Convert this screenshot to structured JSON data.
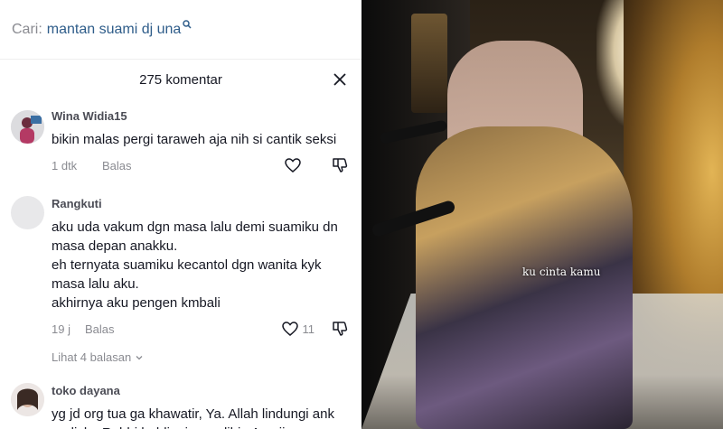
{
  "search": {
    "prefix": "Cari:",
    "query": "mantan suami dj una"
  },
  "comments_header": {
    "title": "275 komentar"
  },
  "comments": [
    {
      "user": "Wina Widia15",
      "text": "bikin malas pergi taraweh aja nih si cantik seksi",
      "time": "1 dtk",
      "reply_label": "Balas",
      "likes": ""
    },
    {
      "user": "Rangkuti",
      "text": "aku uda vakum dgn masa lalu demi suamiku dn masa depan anakku.\neh ternyata suamiku kecantol dgn wanita kyk masa lalu aku.\nakhirnya aku pengen kmbali",
      "time": "19 j",
      "reply_label": "Balas",
      "likes": "11",
      "view_replies": "Lihat 4 balasan"
    },
    {
      "user": "toko dayana",
      "text": "yg jd org tua ga khawatir, Ya. Allah lindungi ank gadisku Robbi habli minassolihin Aamiin...",
      "time": "",
      "reply_label": "",
      "likes": ""
    }
  ],
  "video": {
    "caption": "ku cinta kamu"
  },
  "icons": {
    "search": "search-icon",
    "close": "close-icon",
    "like": "heart-icon",
    "dislike": "thumbs-down-icon",
    "chevron": "chevron-down-icon"
  }
}
